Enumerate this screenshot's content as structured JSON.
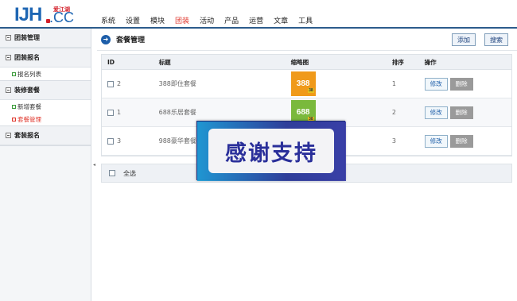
{
  "logo": {
    "main": "IJH",
    "cc": ".CC",
    "sub": "爱江湖"
  },
  "nav": [
    {
      "label": "系统",
      "active": false
    },
    {
      "label": "设置",
      "active": false
    },
    {
      "label": "模块",
      "active": false
    },
    {
      "label": "团装",
      "active": true
    },
    {
      "label": "活动",
      "active": false
    },
    {
      "label": "产品",
      "active": false
    },
    {
      "label": "运营",
      "active": false
    },
    {
      "label": "文章",
      "active": false
    },
    {
      "label": "工具",
      "active": false
    }
  ],
  "sidebar": {
    "sections": [
      {
        "title": "团装管理",
        "items": []
      },
      {
        "title": "团装报名",
        "items": [
          {
            "label": "报名列表",
            "active": false
          }
        ]
      },
      {
        "title": "装修套餐",
        "items": [
          {
            "label": "新增套餐",
            "active": false
          },
          {
            "label": "套餐管理",
            "active": true
          }
        ]
      },
      {
        "title": "套装报名",
        "items": []
      }
    ],
    "collapse_glyph": "◂"
  },
  "main": {
    "title": "套餐管理",
    "add_label": "添加",
    "search_label": "搜索",
    "columns": {
      "id": "ID",
      "title": "标题",
      "thumb": "缩略图",
      "order": "排序",
      "op": "操作"
    },
    "rows": [
      {
        "id": "2",
        "title": "388即住套餐",
        "thumb": "388",
        "thumb_sub": "38",
        "thumb_color": "#f09a1a",
        "order": "1"
      },
      {
        "id": "1",
        "title": "688乐居套餐",
        "thumb": "688",
        "thumb_sub": "38",
        "thumb_color": "#7ab93c",
        "order": "2"
      },
      {
        "id": "3",
        "title": "988豪华套餐",
        "thumb": "",
        "thumb_sub": "",
        "thumb_color": "",
        "order": "3"
      }
    ],
    "edit_label": "修改",
    "delete_label": "删除",
    "select_all_label": "全选"
  },
  "overlay": {
    "text": "感谢支持"
  }
}
